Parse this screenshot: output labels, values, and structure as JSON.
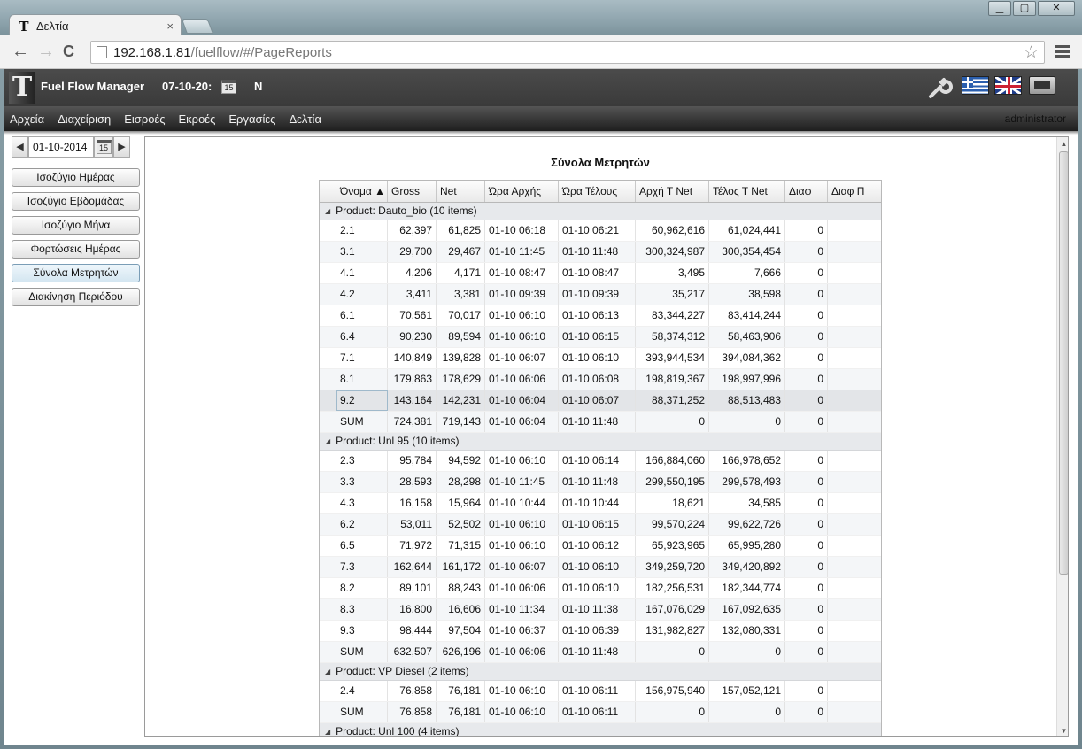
{
  "browser": {
    "tab_title": "Δελτία",
    "tab_close": "×",
    "favicon": "T",
    "url_host": "192.168.1.81",
    "url_path": "/fuelflow/#/PageReports",
    "back": "←",
    "forward": "→",
    "reload": "C",
    "star": "☆",
    "window_buttons": [
      "▁",
      "▢",
      "✕"
    ]
  },
  "app": {
    "logo": "T",
    "title": "Fuel Flow Manager",
    "date": "07-10-20:",
    "cal_day": "15",
    "n_label": "N",
    "menu": [
      "Αρχεία",
      "Διαχείριση",
      "Εισροές",
      "Εκροές",
      "Εργασίες",
      "Δελτία"
    ],
    "user": "administrator"
  },
  "sidebar": {
    "prev": "◀",
    "next": "▶",
    "date_value": "01-10-2014",
    "cal_day": "15",
    "buttons": [
      "Ισοζύγιο Ημέρας",
      "Ισοζύγιο Εβδομάδας",
      "Ισοζύγιο Μήνα",
      "Φορτώσεις Ημέρας",
      "Σύνολα Μετρητών",
      "Διακίνηση Περιόδου"
    ],
    "active_index": 4
  },
  "report": {
    "title": "Σύνολα Μετρητών",
    "columns": [
      "Όνομα ▲",
      "Gross",
      "Net",
      "Ώρα Αρχής",
      "Ώρα Τέλους",
      "Αρχή Τ Net",
      "Τέλος Τ Net",
      "Διαφ",
      "Διαφ Π"
    ],
    "groups": [
      {
        "label": "Product: Dauto_bio (10 items)",
        "rows": [
          [
            "2.1",
            "62,397",
            "61,825",
            "01-10 06:18",
            "01-10 06:21",
            "60,962,616",
            "61,024,441",
            "0",
            ""
          ],
          [
            "3.1",
            "29,700",
            "29,467",
            "01-10 11:45",
            "01-10 11:48",
            "300,324,987",
            "300,354,454",
            "0",
            ""
          ],
          [
            "4.1",
            "4,206",
            "4,171",
            "01-10 08:47",
            "01-10 08:47",
            "3,495",
            "7,666",
            "0",
            ""
          ],
          [
            "4.2",
            "3,411",
            "3,381",
            "01-10 09:39",
            "01-10 09:39",
            "35,217",
            "38,598",
            "0",
            ""
          ],
          [
            "6.1",
            "70,561",
            "70,017",
            "01-10 06:10",
            "01-10 06:13",
            "83,344,227",
            "83,414,244",
            "0",
            ""
          ],
          [
            "6.4",
            "90,230",
            "89,594",
            "01-10 06:10",
            "01-10 06:15",
            "58,374,312",
            "58,463,906",
            "0",
            ""
          ],
          [
            "7.1",
            "140,849",
            "139,828",
            "01-10 06:07",
            "01-10 06:10",
            "393,944,534",
            "394,084,362",
            "0",
            ""
          ],
          [
            "8.1",
            "179,863",
            "178,629",
            "01-10 06:06",
            "01-10 06:08",
            "198,819,367",
            "198,997,996",
            "0",
            ""
          ],
          [
            "9.2",
            "143,164",
            "142,231",
            "01-10 06:04",
            "01-10 06:07",
            "88,371,252",
            "88,513,483",
            "0",
            ""
          ],
          [
            "SUM",
            "724,381",
            "719,143",
            "01-10 06:04",
            "01-10 11:48",
            "0",
            "0",
            "0",
            ""
          ]
        ]
      },
      {
        "label": "Product: Unl 95 (10 items)",
        "rows": [
          [
            "2.3",
            "95,784",
            "94,592",
            "01-10 06:10",
            "01-10 06:14",
            "166,884,060",
            "166,978,652",
            "0",
            ""
          ],
          [
            "3.3",
            "28,593",
            "28,298",
            "01-10 11:45",
            "01-10 11:48",
            "299,550,195",
            "299,578,493",
            "0",
            ""
          ],
          [
            "4.3",
            "16,158",
            "15,964",
            "01-10 10:44",
            "01-10 10:44",
            "18,621",
            "34,585",
            "0",
            ""
          ],
          [
            "6.2",
            "53,011",
            "52,502",
            "01-10 06:10",
            "01-10 06:15",
            "99,570,224",
            "99,622,726",
            "0",
            ""
          ],
          [
            "6.5",
            "71,972",
            "71,315",
            "01-10 06:10",
            "01-10 06:12",
            "65,923,965",
            "65,995,280",
            "0",
            ""
          ],
          [
            "7.3",
            "162,644",
            "161,172",
            "01-10 06:07",
            "01-10 06:10",
            "349,259,720",
            "349,420,892",
            "0",
            ""
          ],
          [
            "8.2",
            "89,101",
            "88,243",
            "01-10 06:06",
            "01-10 06:10",
            "182,256,531",
            "182,344,774",
            "0",
            ""
          ],
          [
            "8.3",
            "16,800",
            "16,606",
            "01-10 11:34",
            "01-10 11:38",
            "167,076,029",
            "167,092,635",
            "0",
            ""
          ],
          [
            "9.3",
            "98,444",
            "97,504",
            "01-10 06:37",
            "01-10 06:39",
            "131,982,827",
            "132,080,331",
            "0",
            ""
          ],
          [
            "SUM",
            "632,507",
            "626,196",
            "01-10 06:06",
            "01-10 11:48",
            "0",
            "0",
            "0",
            ""
          ]
        ]
      },
      {
        "label": "Product: VP Diesel (2 items)",
        "rows": [
          [
            "2.4",
            "76,858",
            "76,181",
            "01-10 06:10",
            "01-10 06:11",
            "156,975,940",
            "157,052,121",
            "0",
            ""
          ],
          [
            "SUM",
            "76,858",
            "76,181",
            "01-10 06:10",
            "01-10 06:11",
            "0",
            "0",
            "0",
            ""
          ]
        ]
      },
      {
        "label": "Product: Unl 100 (4 items)",
        "rows": []
      }
    ],
    "selected_row": {
      "group": 0,
      "row": 8
    }
  }
}
